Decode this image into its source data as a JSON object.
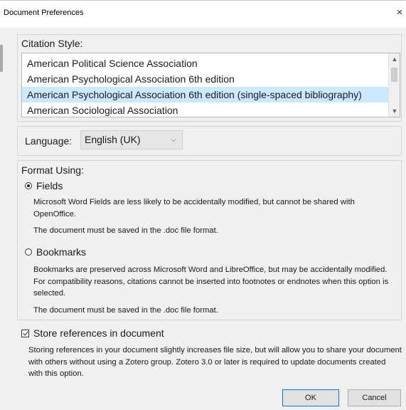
{
  "window": {
    "title": "Document Preferences",
    "close_glyph": "×"
  },
  "citation_style": {
    "label": "Citation Style:",
    "items": [
      "American Political Science Association",
      "American Psychological Association 6th edition",
      "American Psychological Association 6th edition (single-spaced bibliography)",
      "American Sociological Association"
    ],
    "selected_index": 2
  },
  "language": {
    "label": "Language:",
    "selected": "English (UK)"
  },
  "format_using": {
    "label": "Format Using:",
    "fields": {
      "label": "Fields",
      "checked": true,
      "desc1": "Microsoft Word Fields are less likely to be accidentally modified, but cannot be shared with OpenOffice.",
      "desc2": "The document must be saved in the .doc file format."
    },
    "bookmarks": {
      "label": "Bookmarks",
      "checked": false,
      "desc1": "Bookmarks are preserved across Microsoft Word and LibreOffice, but may be accidentally modified. For compatibility reasons, citations cannot be inserted into footnotes or endnotes when this option is selected.",
      "desc2": "The document must be saved in the .doc file format."
    }
  },
  "store_references": {
    "label": "Store references in document",
    "checked": true,
    "desc": "Storing references in your document slightly increases file size, but will allow you to share your document with others without using a Zotero group. Zotero 3.0 or later is required to update documents created with this option."
  },
  "buttons": {
    "ok": "OK",
    "cancel": "Cancel"
  },
  "colors": {
    "selection": "#cce8ff",
    "accent_border": "#0078d7"
  },
  "icons": {
    "scroll_up": "chevron-up-icon",
    "scroll_down": "chevron-down-icon",
    "dropdown": "chevron-down-icon"
  }
}
